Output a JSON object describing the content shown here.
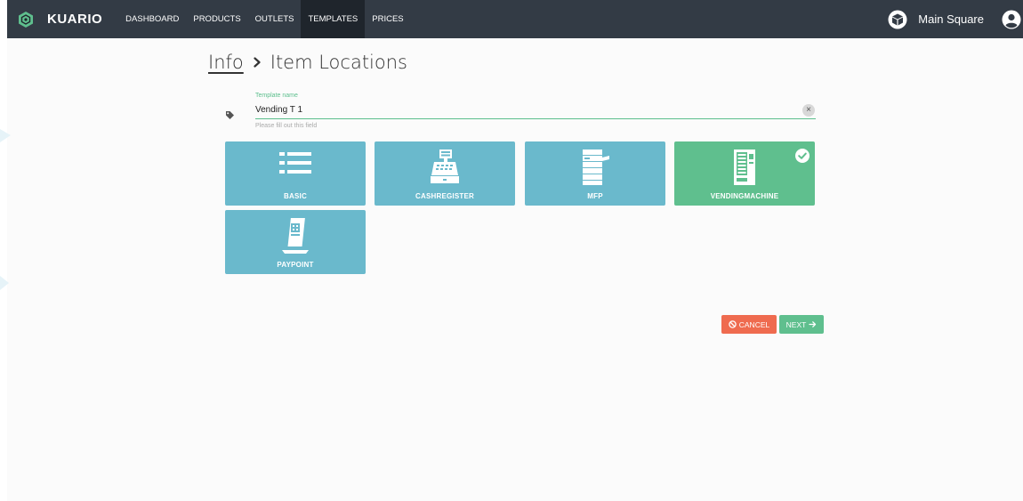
{
  "navbar": {
    "brand": "KUARIO",
    "items": [
      {
        "label": "DASHBOARD"
      },
      {
        "label": "PRODUCTS"
      },
      {
        "label": "OUTLETS"
      },
      {
        "label": "TEMPLATES"
      },
      {
        "label": "PRICES"
      }
    ],
    "active_item": "TEMPLATES",
    "outlet_name": "Main Square"
  },
  "breadcrumb": {
    "parent": "Info",
    "current": "Item Locations"
  },
  "form": {
    "label": "Template name",
    "value": "Vending T 1",
    "help": "Please fill out this field",
    "clear": "×"
  },
  "tiles": [
    {
      "label": "BASIC",
      "icon": "list-icon",
      "selected": false
    },
    {
      "label": "CASHREGISTER",
      "icon": "cash-register-icon",
      "selected": false
    },
    {
      "label": "MFP",
      "icon": "printer-icon",
      "selected": false
    },
    {
      "label": "VENDINGMACHINE",
      "icon": "vending-machine-icon",
      "selected": true
    },
    {
      "label": "PAYPOINT",
      "icon": "qr-stand-icon",
      "selected": false
    }
  ],
  "actions": {
    "cancel": "CANCEL",
    "next": "NEXT"
  },
  "colors": {
    "navbar": "#333b45",
    "tile": "#6ab9cc",
    "tile_selected": "#5fbf8e",
    "cancel": "#ef6b4f",
    "next": "#5fbf8e"
  }
}
